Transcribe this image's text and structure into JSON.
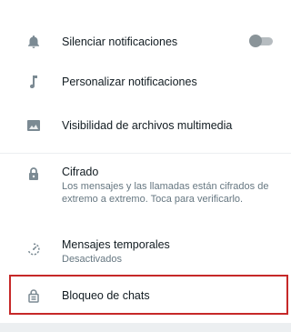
{
  "settings": {
    "mute": {
      "label": "Silenciar notificaciones",
      "toggle_on": false
    },
    "custom_notifications": {
      "label": "Personalizar notificaciones"
    },
    "media_visibility": {
      "label": "Visibilidad de archivos multimedia"
    },
    "encryption": {
      "label": "Cifrado",
      "description": "Los mensajes y las llamadas están cifrados de extremo a extremo. Toca para verificarlo."
    },
    "disappearing_messages": {
      "label": "Mensajes temporales",
      "status": "Desactivados"
    },
    "chat_lock": {
      "label": "Bloqueo de chats"
    }
  },
  "colors": {
    "icon": "#7b8a93",
    "highlight": "#c62828",
    "secondary_text": "#667781"
  },
  "icons": {
    "mute": "bell-icon",
    "custom_notifications": "music-note-icon",
    "media_visibility": "image-icon",
    "encryption": "lock-icon",
    "disappearing_messages": "timer-icon",
    "chat_lock": "chat-lock-icon"
  }
}
